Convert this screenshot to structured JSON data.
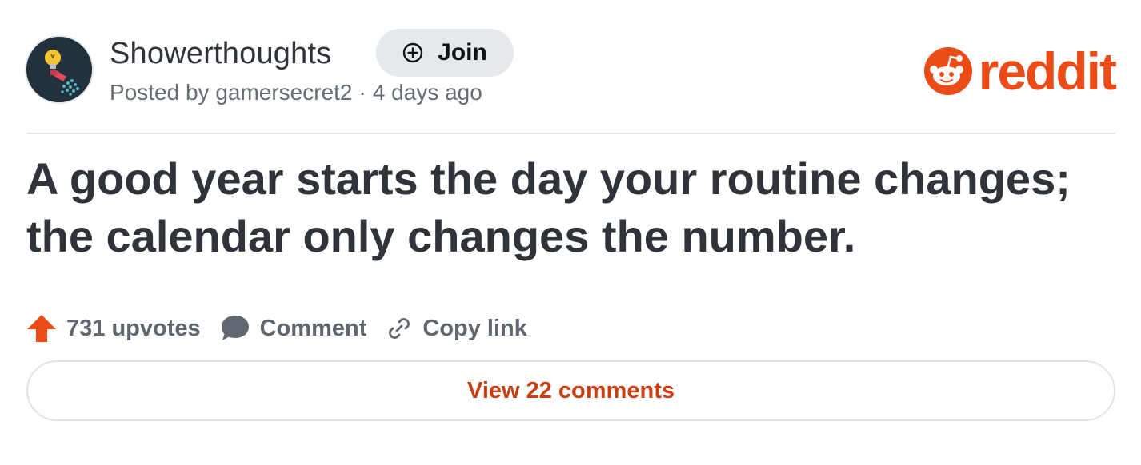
{
  "post": {
    "subreddit": "Showerthoughts",
    "join_label": "Join",
    "posted_by_prefix": "Posted by",
    "author": "gamersecret2",
    "separator": "·",
    "age": "4 days ago",
    "title": "A good year starts the day your routine changes; the calendar only changes the number."
  },
  "brand": {
    "wordmark": "reddit",
    "color": "#eb4b16"
  },
  "actions": {
    "upvotes": "731 upvotes",
    "comment": "Comment",
    "copy_link": "Copy link"
  },
  "footer": {
    "view_comments": "View 22 comments"
  },
  "colors": {
    "upvote": "#eb4b16",
    "link_text": "#cc3d0f",
    "avatar_bg": "#22313c"
  },
  "icons": {
    "avatar": "lightbulb-shower-icon",
    "join": "plus-circle-icon",
    "upvote": "upvote-arrow-icon",
    "comment": "comment-bubble-icon",
    "copy_link": "link-chain-icon",
    "brand": "reddit-snoo-icon"
  }
}
